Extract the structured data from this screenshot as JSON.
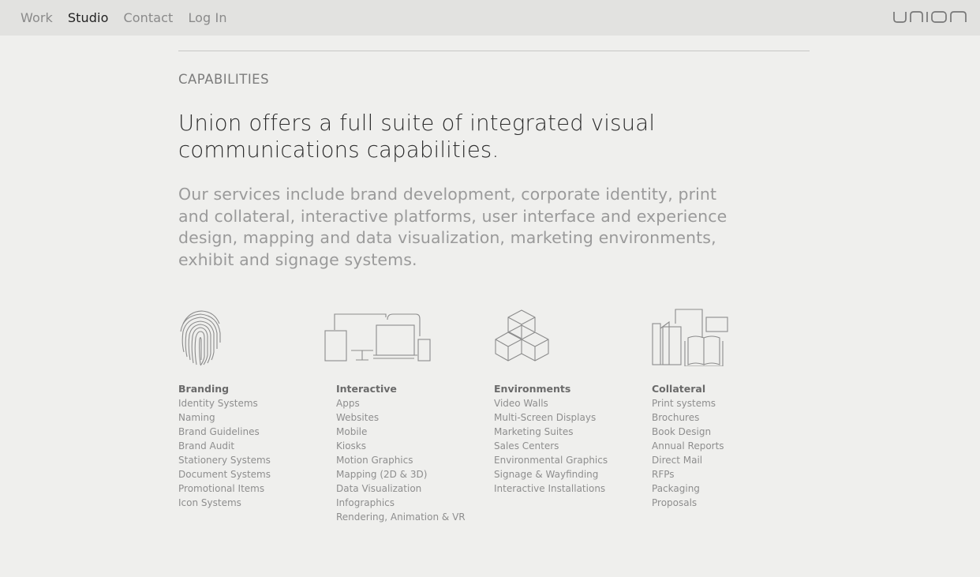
{
  "nav": {
    "items": [
      {
        "label": "Work",
        "active": false
      },
      {
        "label": "Studio",
        "active": true
      },
      {
        "label": "Contact",
        "active": false
      },
      {
        "label": "Log In",
        "active": false
      }
    ],
    "logo_text": "union"
  },
  "section": {
    "eyebrow": "CAPABILITIES",
    "headline": "Union offers a full suite of integrated visual communications capabilities.",
    "lede": "Our services include brand development, corporate identity, print and collateral, interactive platforms, user interface and experience design, mapping and data visualization, marketing environments, exhibit and signage systems."
  },
  "columns": [
    {
      "icon": "fingerprint-icon",
      "title": "Branding",
      "items": [
        "Identity Systems",
        "Naming",
        "Brand Guidelines",
        "Brand Audit",
        "Stationery Systems",
        "Document Systems",
        "Promotional Items",
        "Icon Systems"
      ]
    },
    {
      "icon": "devices-icon",
      "title": "Interactive",
      "items": [
        "Apps",
        "Websites",
        "Mobile",
        "Kiosks",
        "Motion Graphics",
        "Mapping (2D & 3D)",
        "Data Visualization",
        "Infographics",
        "Rendering, Animation & VR"
      ]
    },
    {
      "icon": "cubes-icon",
      "title": "Environments",
      "items": [
        "Video Walls",
        "Multi-Screen Displays",
        "Marketing Suites",
        "Sales Centers",
        "Environmental Graphics",
        "Signage & Wayfinding",
        "Interactive Installations"
      ]
    },
    {
      "icon": "print-collateral-icon",
      "title": "Collateral",
      "items": [
        "Print systems",
        "Brochures",
        "Book Design",
        "Annual Reports",
        "Direct Mail",
        "RFPs",
        "Packaging",
        "Proposals"
      ]
    }
  ],
  "colors": {
    "background": "#efefed",
    "topbar": "#e2e2e0",
    "nav_text": "#8a8a8a",
    "nav_active": "#222222",
    "icon_stroke": "#8c8c8c"
  }
}
